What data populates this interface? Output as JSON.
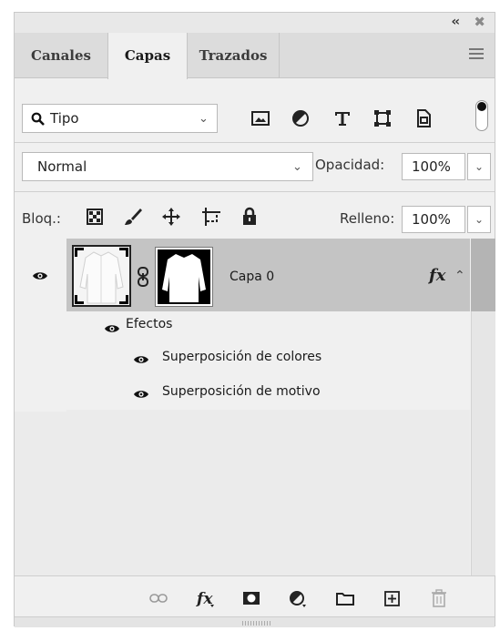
{
  "panel": {
    "tabs": [
      {
        "label": "Canales",
        "active": false
      },
      {
        "label": "Capas",
        "active": true
      },
      {
        "label": "Trazados",
        "active": false
      }
    ]
  },
  "filter": {
    "kind_label": "Tipo",
    "icons": [
      "image-filter-icon",
      "adjustment-filter-icon",
      "type-filter-icon",
      "shape-filter-icon",
      "smart-object-filter-icon"
    ]
  },
  "blend": {
    "mode": "Normal",
    "opacity_label": "Opacidad:",
    "opacity_value": "100%"
  },
  "lock": {
    "label": "Bloq.:",
    "fill_label": "Relleno:",
    "fill_value": "100%"
  },
  "layers": [
    {
      "name": "Capa 0",
      "fx": "fx",
      "effects_label": "Efectos",
      "effects": [
        "Superposición de colores",
        "Superposición de motivo"
      ]
    }
  ],
  "colors": {
    "panel_bg": "#f0f0f0",
    "selected_layer": "#c4c4c4",
    "tabbar": "#dcdcdc"
  }
}
